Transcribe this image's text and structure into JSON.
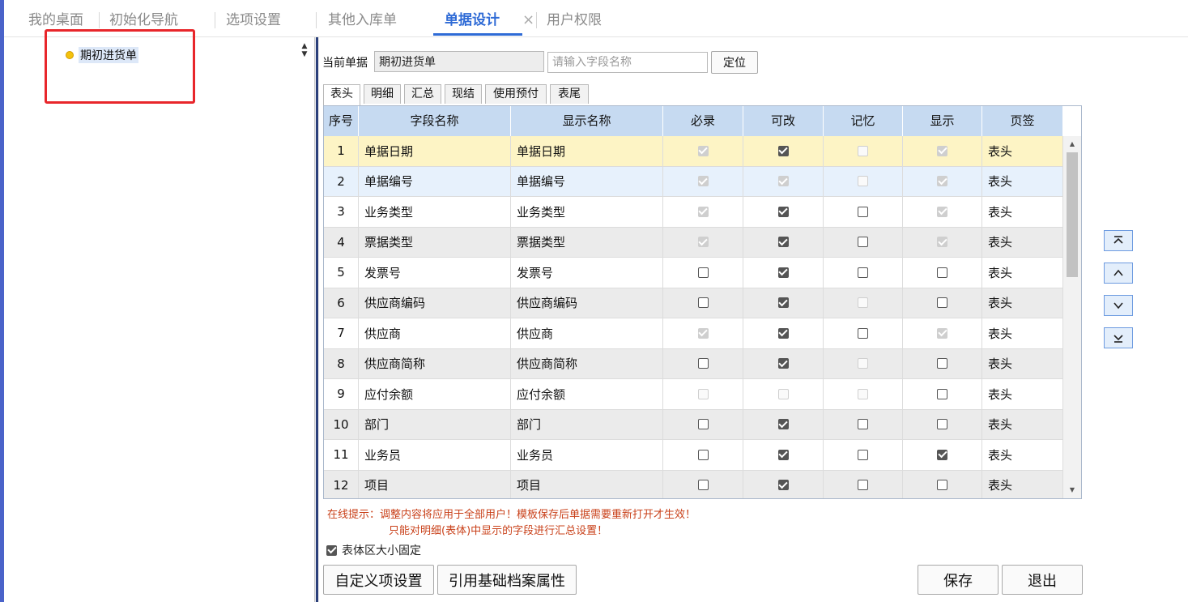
{
  "top_tabs": [
    {
      "label": "我的桌面"
    },
    {
      "label": "初始化导航"
    },
    {
      "label": "选项设置"
    },
    {
      "label": "其他入库单"
    },
    {
      "label": "单据设计",
      "close": "×"
    },
    {
      "label": "用户权限"
    }
  ],
  "tree": {
    "item": "期初进货单"
  },
  "form": {
    "current_label": "当前单据",
    "current_value": "期初进货单",
    "search_placeholder": "请输入字段名称",
    "locate_label": "定位"
  },
  "sub_tabs": [
    "表头",
    "明细",
    "汇总",
    "现结",
    "使用预付",
    "表尾"
  ],
  "grid": {
    "columns": [
      "序号",
      "字段名称",
      "显示名称",
      "必录",
      "可改",
      "记忆",
      "显示",
      "页签"
    ],
    "rows": [
      {
        "no": "1",
        "field": "单据日期",
        "display": "单据日期",
        "required": [
          true,
          true
        ],
        "editable": [
          true,
          false
        ],
        "memory": [
          false,
          true
        ],
        "show": [
          true,
          true
        ],
        "tab": "表头"
      },
      {
        "no": "2",
        "field": "单据编号",
        "display": "单据编号",
        "required": [
          true,
          true
        ],
        "editable": [
          true,
          true
        ],
        "memory": [
          false,
          true
        ],
        "show": [
          true,
          true
        ],
        "tab": "表头"
      },
      {
        "no": "3",
        "field": "业务类型",
        "display": "业务类型",
        "required": [
          true,
          true
        ],
        "editable": [
          true,
          false
        ],
        "memory": [
          false,
          false
        ],
        "show": [
          true,
          true
        ],
        "tab": "表头"
      },
      {
        "no": "4",
        "field": "票据类型",
        "display": "票据类型",
        "required": [
          true,
          true
        ],
        "editable": [
          true,
          false
        ],
        "memory": [
          false,
          false
        ],
        "show": [
          true,
          true
        ],
        "tab": "表头"
      },
      {
        "no": "5",
        "field": "发票号",
        "display": "发票号",
        "required": [
          false,
          false
        ],
        "editable": [
          true,
          false
        ],
        "memory": [
          false,
          false
        ],
        "show": [
          false,
          false
        ],
        "tab": "表头"
      },
      {
        "no": "6",
        "field": "供应商编码",
        "display": "供应商编码",
        "required": [
          false,
          false
        ],
        "editable": [
          true,
          false
        ],
        "memory": [
          false,
          true
        ],
        "show": [
          false,
          false
        ],
        "tab": "表头"
      },
      {
        "no": "7",
        "field": "供应商",
        "display": "供应商",
        "required": [
          true,
          true
        ],
        "editable": [
          true,
          false
        ],
        "memory": [
          false,
          false
        ],
        "show": [
          true,
          true
        ],
        "tab": "表头"
      },
      {
        "no": "8",
        "field": "供应商简称",
        "display": "供应商简称",
        "required": [
          false,
          false
        ],
        "editable": [
          true,
          false
        ],
        "memory": [
          false,
          true
        ],
        "show": [
          false,
          false
        ],
        "tab": "表头"
      },
      {
        "no": "9",
        "field": "应付余额",
        "display": "应付余额",
        "required": [
          false,
          true
        ],
        "editable": [
          false,
          true
        ],
        "memory": [
          false,
          true
        ],
        "show": [
          false,
          false
        ],
        "tab": "表头"
      },
      {
        "no": "10",
        "field": "部门",
        "display": "部门",
        "required": [
          false,
          false
        ],
        "editable": [
          true,
          false
        ],
        "memory": [
          false,
          false
        ],
        "show": [
          false,
          false
        ],
        "tab": "表头"
      },
      {
        "no": "11",
        "field": "业务员",
        "display": "业务员",
        "required": [
          false,
          false
        ],
        "editable": [
          true,
          false
        ],
        "memory": [
          false,
          false
        ],
        "show": [
          true,
          false
        ],
        "tab": "表头"
      },
      {
        "no": "12",
        "field": "项目",
        "display": "项目",
        "required": [
          false,
          false
        ],
        "editable": [
          true,
          false
        ],
        "memory": [
          false,
          false
        ],
        "show": [
          false,
          false
        ],
        "tab": "表头"
      }
    ]
  },
  "tips": {
    "line1": "在线提示：调整内容将应用于全部用户！模板保存后单据需要重新打开才生效！",
    "line2": "只能对明细(表体)中显示的字段进行汇总设置！"
  },
  "fixed_size": {
    "label": "表体区大小固定",
    "checked": true
  },
  "buttons": {
    "custom": "自定义项设置",
    "ref": "引用基础档案属性",
    "save": "保存",
    "exit": "退出"
  },
  "move_buttons": [
    "move-top-icon",
    "move-up-icon",
    "move-down-icon",
    "move-bottom-icon"
  ],
  "colors": {
    "accent": "#2f6bd6",
    "header": "#c6daf1",
    "selected_row": "#fdf4c5",
    "tip": "#c9411a",
    "highlight": "#e8262b"
  }
}
